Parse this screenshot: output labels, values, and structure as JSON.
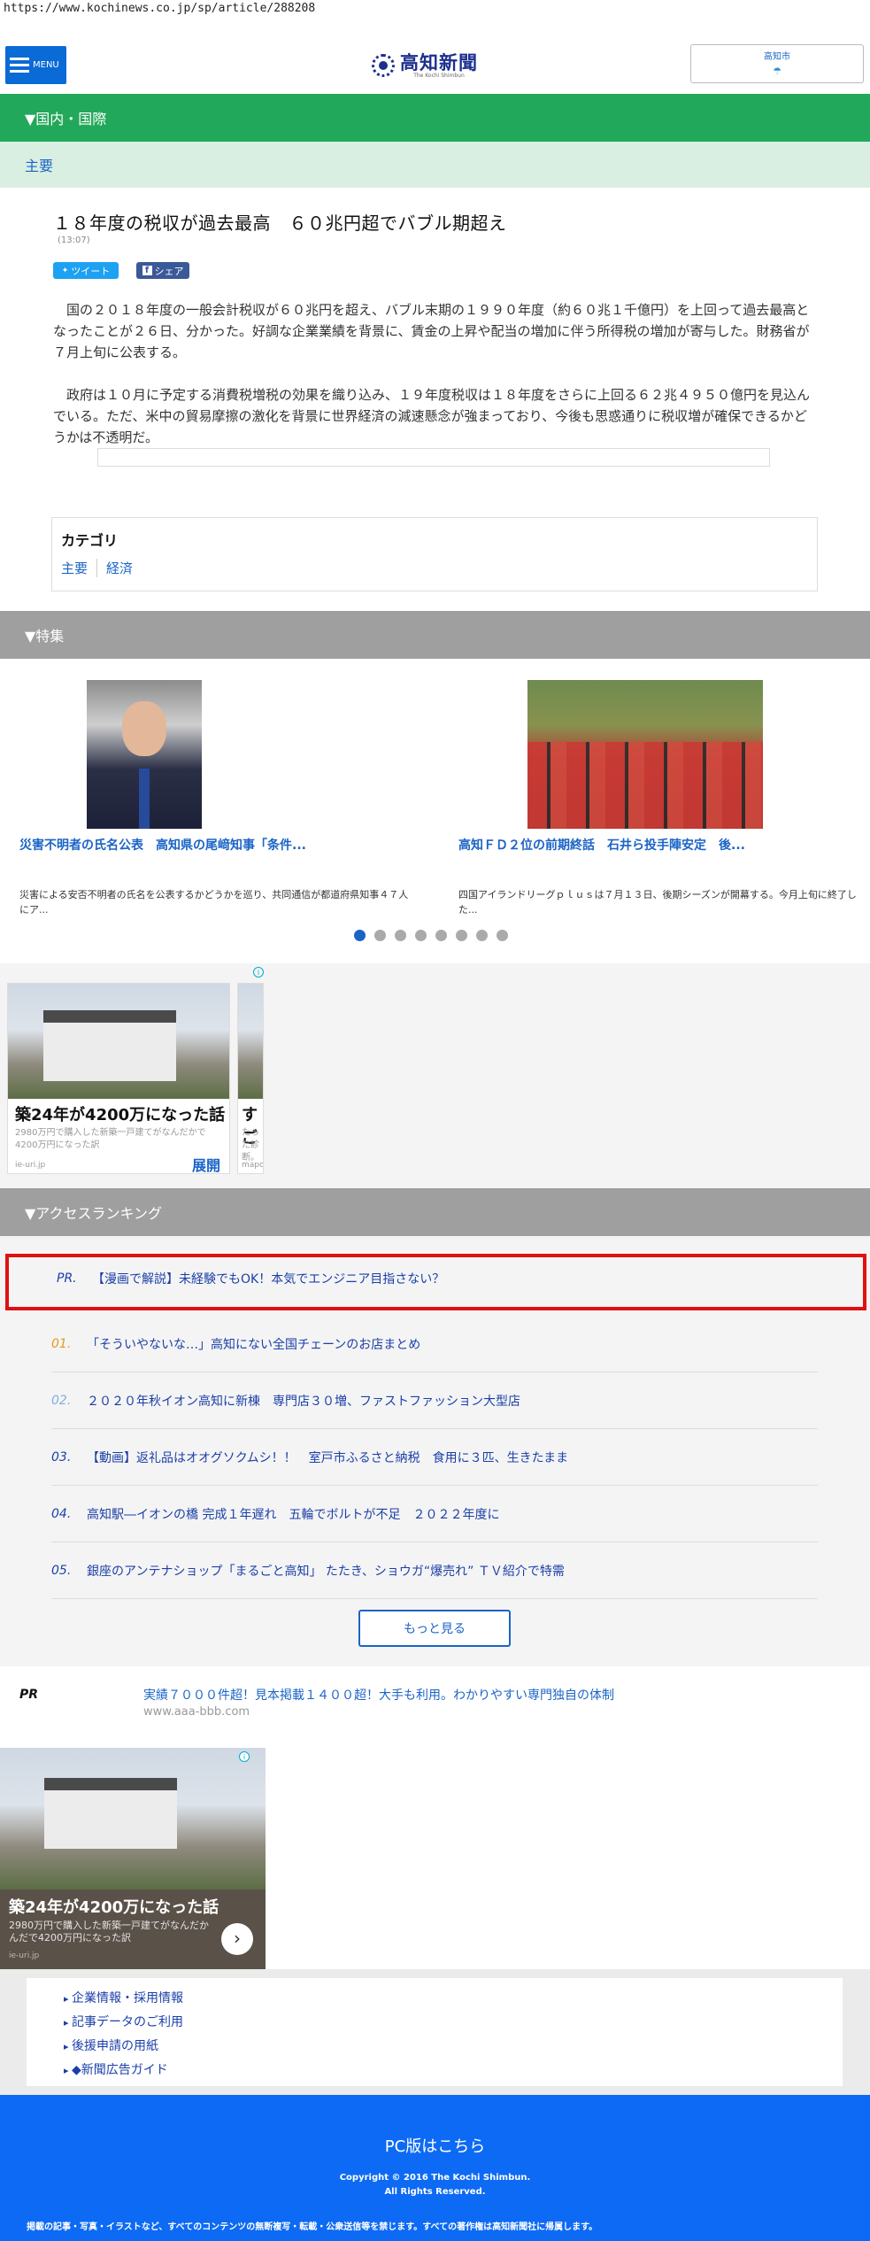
{
  "url": "https://www.kochinews.co.jp/sp/article/288208",
  "header": {
    "menu_label": "MENU",
    "logo_text": "高知新聞",
    "logo_en": "The Kochi Shimbun",
    "weather_city": "高知市",
    "weather_icon": "☂"
  },
  "section_domestic": "▼国内・国際",
  "subsection": "主要",
  "article": {
    "title": "１８年度の税収が過去最高　６０兆円超でバブル期超え",
    "time": "(13:07)",
    "tweet_label": "ツイート",
    "share_label": "シェア",
    "paragraph1": "国の２０１８年度の一般会計税収が６０兆円を超え、バブル末期の１９９０年度（約６０兆１千億円）を上回って過去最高となったことが２６日、分かった。好調な企業業績を背景に、賃金の上昇や配当の増加に伴う所得税の増加が寄与した。財務省が７月上旬に公表する。",
    "paragraph2": "政府は１０月に予定する消費税増税の効果を織り込み、１９年度税収は１８年度をさらに上回る６２兆４９５０億円を見込んでいる。ただ、米中の貿易摩擦の激化を背景に世界経済の減速懸念が強まっており、今後も思惑通りに税収増が確保できるかどうかは不透明だ。"
  },
  "category": {
    "title": "カテゴリ",
    "links": [
      "主要",
      "経済"
    ]
  },
  "section_feature": "▼特集",
  "features": [
    {
      "link": "災害不明者の氏名公表　高知県の尾﨑知事「条件...",
      "desc": "災害による安否不明者の氏名を公表するかどうかを巡り、共同通信が都道府県知事４７人にア..."
    },
    {
      "link": "高知ＦＤ２位の前期終話　石井ら投手陣安定　後...",
      "desc": "四国アイランドリーグｐｌｕｓは７月１３日、後期シーズンが開幕する。今月上旬に終了した..."
    }
  ],
  "carousel": {
    "count": 8,
    "active": 0
  },
  "ads": [
    {
      "title": "築24年が4200万になった話",
      "sub": "2980万円で購入した新築一戸建てがなんだかで4200万円になった訳",
      "src": "ie-uri.jp",
      "expand": "展開"
    },
    {
      "title": "すご",
      "sub": "たった診断。",
      "src": "mapo"
    }
  ],
  "section_ranking": "▼アクセスランキング",
  "ranking": {
    "pr_label": "PR.",
    "pr_text": "【漫画で解説】未経験でもOK！本気でエンジニア目指さない？",
    "items": [
      {
        "num": "01.",
        "text": "「そういやないな…」高知にない全国チェーンのお店まとめ",
        "color": "#e39a1e"
      },
      {
        "num": "02.",
        "text": "２０２０年秋イオン高知に新棟　専門店３０増、ファストファッション大型店",
        "color": "#7fb0e0"
      },
      {
        "num": "03.",
        "text": "【動画】返礼品はオオグソクムシ！！　室戸市ふるさと納税　食用に３匹、生きたまま",
        "color": "#1b3fa8"
      },
      {
        "num": "04.",
        "text": "高知駅―イオンの橋 完成１年遅れ　五輪でボルトが不足　２０２２年度に",
        "color": "#1b3fa8"
      },
      {
        "num": "05.",
        "text": "銀座のアンテナショップ「まるごと高知」 たたき、ショウガ“爆売れ” ＴＶ紹介で特需",
        "color": "#1b3fa8"
      }
    ],
    "more_label": "もっと見る"
  },
  "pr_ad": {
    "label": "PR",
    "link": "実績７０００件超！見本掲載１４００超！大手も利用。わかりやすい専門独自の体制",
    "domain": "www.aaa-bbb.com"
  },
  "ad2": {
    "title": "築24年が4200万になった話",
    "sub": "2980万円で購入した新築一戸建てがなんだかんだで4200万円になった訳",
    "src": "ie-uri.jp",
    "arrow": "›"
  },
  "footer_links": [
    "企業情報・採用情報",
    "記事データのご利用",
    "後援申請の用紙",
    "◆新聞広告ガイド"
  ],
  "footer": {
    "pc_link": "PC版はこちら",
    "copyright1": "Copyright © 2016 The Kochi Shimbun.",
    "copyright2": "All Rights Reserved.",
    "notice": "掲載の記事・写真・イラストなど、すべてのコンテンツの無断複写・転載・公衆送信等を禁じます。すべての著作権は高知新聞社に帰属します。"
  },
  "colors": {
    "green_bar": "#22a85a",
    "gray_bar": "#9f9f9f",
    "link_blue": "#1b64c6",
    "footer_blue": "#0d6af4",
    "highlight_red": "#e01010"
  }
}
